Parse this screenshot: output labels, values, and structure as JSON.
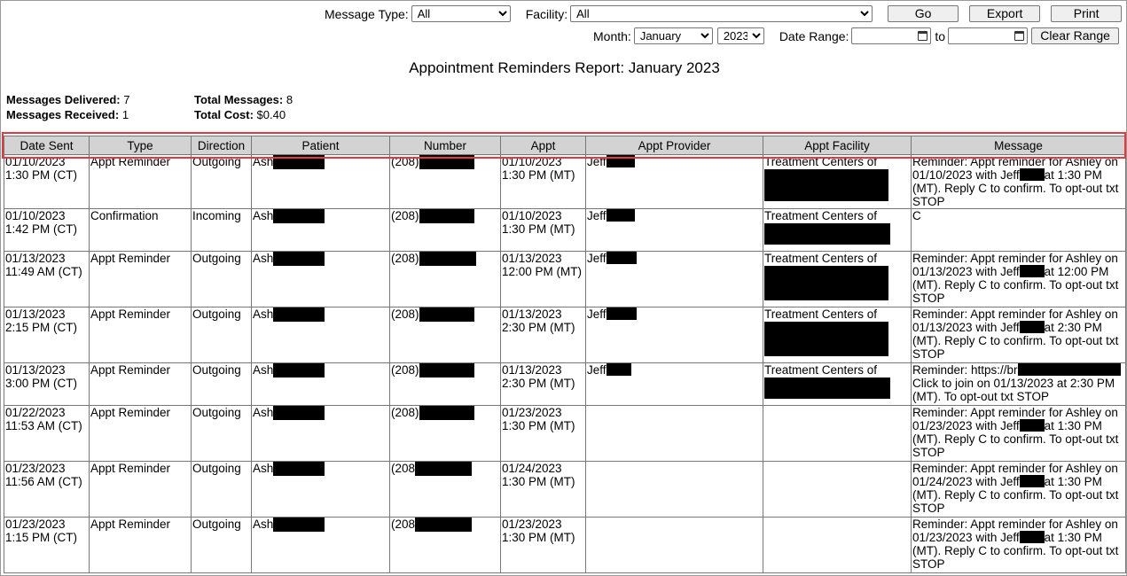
{
  "filters": {
    "message_type_label": "Message Type:",
    "message_type_value": "All",
    "facility_label": "Facility:",
    "facility_value": "All",
    "go_label": "Go",
    "export_label": "Export",
    "print_label": "Print",
    "month_label": "Month:",
    "month_value": "January",
    "year_value": "2023",
    "date_range_label": "Date Range:",
    "to_label": "to",
    "clear_range_label": "Clear Range"
  },
  "report_title": "Appointment Reminders Report: January 2023",
  "stats": {
    "delivered_label": "Messages Delivered:",
    "delivered_value": "7",
    "received_label": "Messages Received:",
    "received_value": "1",
    "total_label": "Total Messages:",
    "total_value": "8",
    "cost_label": "Total Cost:",
    "cost_value": "$0.40"
  },
  "columns": [
    "Date Sent",
    "Type",
    "Direction",
    "Patient",
    "Number",
    "Appt",
    "Appt Provider",
    "Appt Facility",
    "Message"
  ],
  "rows": [
    {
      "date_sent": [
        "01/10/2023",
        "1:30 PM (CT)"
      ],
      "type": "Appt Reminder",
      "direction": "Outgoing",
      "patient": "Ash",
      "number": "(208)",
      "appt": [
        "01/10/2023",
        "1:30 PM (MT)"
      ],
      "provider": "Jeff",
      "facility": "Treatment Centers of",
      "message": [
        "Reminder: Appt reminder for Ashley on",
        "01/10/2023 with Jeff",
        "at 1:30 PM",
        "(MT). Reply C to confirm. To opt-out txt",
        "STOP"
      ]
    },
    {
      "date_sent": [
        "01/10/2023",
        "1:42 PM (CT)"
      ],
      "type": "Confirmation",
      "direction": "Incoming",
      "patient": "Ash",
      "number": "(208)",
      "appt": [
        "01/10/2023",
        "1:30 PM (MT)"
      ],
      "provider": "Jeff",
      "facility": "Treatment Centers of",
      "message": [
        "C"
      ]
    },
    {
      "date_sent": [
        "01/13/2023",
        "11:49 AM (CT)"
      ],
      "type": "Appt Reminder",
      "direction": "Outgoing",
      "patient": "Ash",
      "number": "(208)",
      "appt": [
        "01/13/2023",
        "12:00 PM (MT)"
      ],
      "provider": "Jeff",
      "facility": "Treatment Centers of",
      "message": [
        "Reminder: Appt reminder for Ashley on",
        "01/13/2023 with Jeff",
        "at 12:00 PM",
        "(MT). Reply C to confirm. To opt-out txt",
        "STOP"
      ]
    },
    {
      "date_sent": [
        "01/13/2023",
        "2:15 PM (CT)"
      ],
      "type": "Appt Reminder",
      "direction": "Outgoing",
      "patient": "Ash",
      "number": "(208)",
      "appt": [
        "01/13/2023",
        "2:30 PM (MT)"
      ],
      "provider": "Jeff",
      "facility": "Treatment Centers of",
      "message": [
        "Reminder: Appt reminder for Ashley on",
        "01/13/2023 with Jeff",
        "at 2:30 PM",
        "(MT). Reply C to confirm. To opt-out txt",
        "STOP"
      ]
    },
    {
      "date_sent": [
        "01/13/2023",
        "3:00 PM (CT)"
      ],
      "type": "Appt Reminder",
      "direction": "Outgoing",
      "patient": "Ash",
      "number": "(208)",
      "appt": [
        "01/13/2023",
        "2:30 PM (MT)"
      ],
      "provider": "Jeff",
      "facility": "Treatment Centers of",
      "message": [
        "Reminder: https://br",
        "Click to join on 01/13/2023 at 2:30 PM",
        "(MT). To opt-out txt STOP"
      ]
    },
    {
      "date_sent": [
        "01/22/2023",
        "11:53 AM (CT)"
      ],
      "type": "Appt Reminder",
      "direction": "Outgoing",
      "patient": "Ash",
      "number": "(208)",
      "appt": [
        "01/23/2023",
        "1:30 PM (MT)"
      ],
      "provider": "",
      "facility": "",
      "message": [
        "Reminder: Appt reminder for Ashley on",
        "01/23/2023 with Jeff",
        "at 1:30 PM",
        "(MT). Reply C to confirm. To opt-out txt",
        "STOP"
      ]
    },
    {
      "date_sent": [
        "01/23/2023",
        "11:56 AM (CT)"
      ],
      "type": "Appt Reminder",
      "direction": "Outgoing",
      "patient": "Ash",
      "number": "(208",
      "appt": [
        "01/24/2023",
        "1:30 PM (MT)"
      ],
      "provider": "",
      "facility": "",
      "message": [
        "Reminder: Appt reminder for Ashley on",
        "01/24/2023 with Jeff",
        "at 1:30 PM",
        "(MT). Reply C to confirm. To opt-out txt",
        "STOP"
      ]
    },
    {
      "date_sent": [
        "01/23/2023",
        "1:15 PM (CT)"
      ],
      "type": "Appt Reminder",
      "direction": "Outgoing",
      "patient": "Ash",
      "number": "(208",
      "appt": [
        "01/23/2023",
        "1:30 PM (MT)"
      ],
      "provider": "",
      "facility": "",
      "message": [
        "Reminder: Appt reminder for Ashley on",
        "01/23/2023 with Jeff",
        "at 1:30 PM",
        "(MT). Reply C to confirm. To opt-out txt",
        "STOP"
      ]
    }
  ]
}
